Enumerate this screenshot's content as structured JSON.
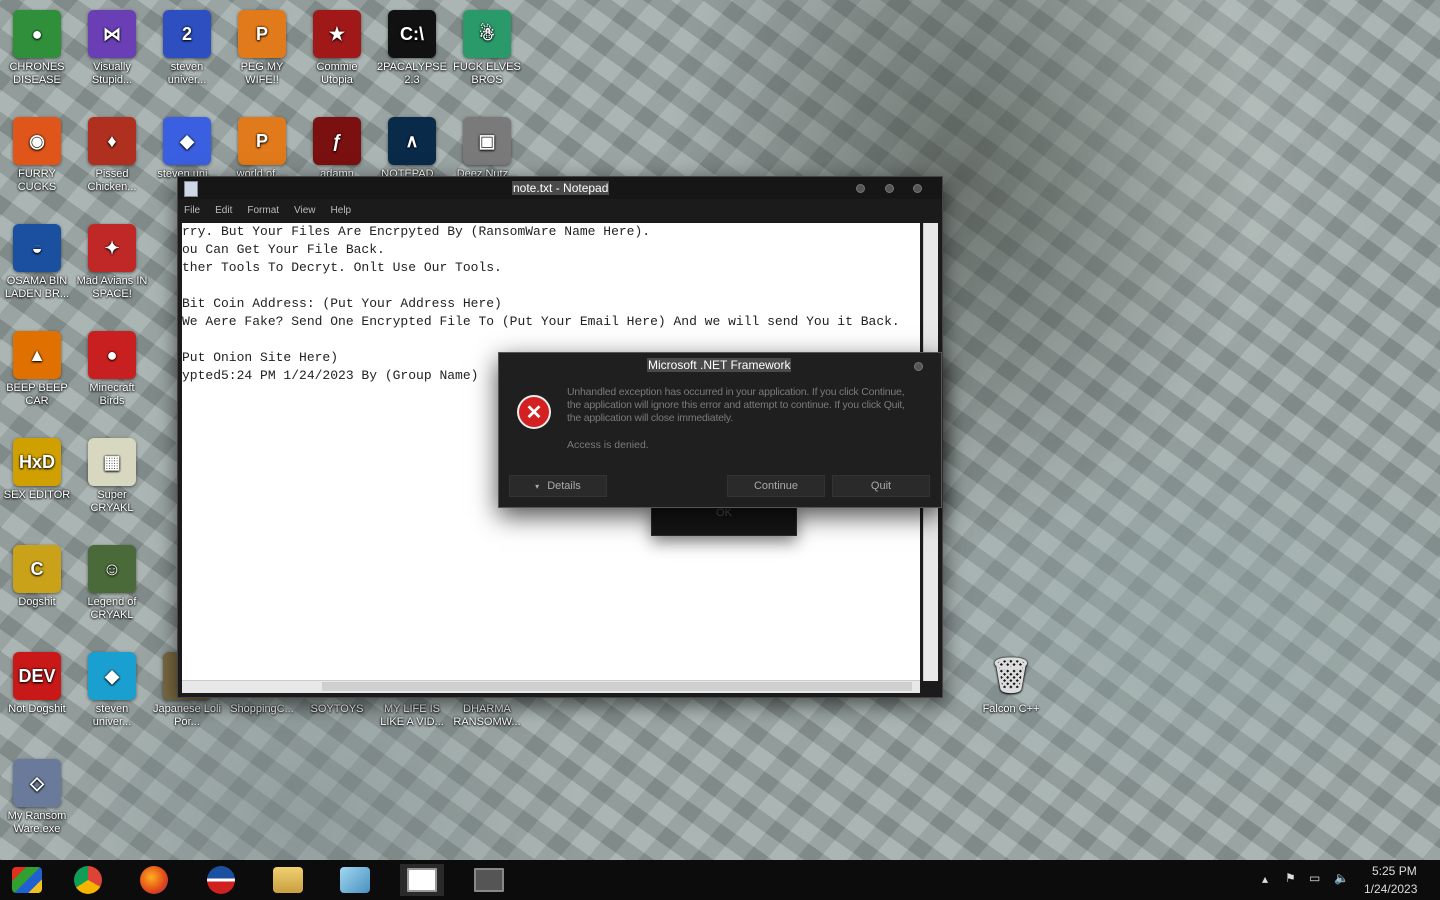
{
  "desktop_icons": [
    {
      "label": "CHRONES DISEASE",
      "icon": "chrome-icon",
      "color": "#2f8f3a",
      "glyph": "●"
    },
    {
      "label": "Visually Stupid...",
      "icon": "visual-studio-icon",
      "color": "#6a3fb5",
      "glyph": "⋈"
    },
    {
      "label": "steven univer...",
      "icon": "number-2-icon",
      "color": "#2d4fbf",
      "glyph": "2"
    },
    {
      "label": "PEG MY WIFE!!",
      "icon": "peggle-icon",
      "color": "#e07a1a",
      "glyph": "P"
    },
    {
      "label": "Commie Utopia",
      "icon": "commie-utopia-icon",
      "color": "#a01818",
      "glyph": "★"
    },
    {
      "label": "2PACALYPSE 2.3",
      "icon": "cmd-icon",
      "color": "#111111",
      "glyph": "C:\\"
    },
    {
      "label": "FUCK ELVES BROS",
      "icon": "elf-game-icon",
      "color": "#2a9a6a",
      "glyph": "☃"
    },
    {
      "label": "FURRY CUCKS",
      "icon": "firefox-icon",
      "color": "#e0561a",
      "glyph": "◉"
    },
    {
      "label": "Pissed Chicken...",
      "icon": "angry-birds-seasons-icon",
      "color": "#b03020",
      "glyph": "♦"
    },
    {
      "label": "steven uni...",
      "icon": "gem-icon",
      "color": "#3a5fe0",
      "glyph": "◆"
    },
    {
      "label": "world of ...",
      "icon": "peggle-icon",
      "color": "#e07a1a",
      "glyph": "P"
    },
    {
      "label": "adamn lanza...",
      "icon": "flash-icon",
      "color": "#7a1010",
      "glyph": "ƒ"
    },
    {
      "label": "NOTEPAD...",
      "icon": "notepad-plus-icon",
      "color": "#0a2a4a",
      "glyph": "∧"
    },
    {
      "label": "Deez Nutz...",
      "icon": "windows-stack-icon",
      "color": "#7a7a7a",
      "glyph": "▣"
    },
    {
      "label": "OSAMA BIN LADEN BR...",
      "icon": "obama-logo-icon",
      "color": "#1b4fa0",
      "glyph": "◒"
    },
    {
      "label": "Mad Avians IN SPACE!",
      "icon": "angry-birds-space-icon",
      "color": "#c02828",
      "glyph": "✦"
    },
    {
      "label": "BEEP BEEP CAR",
      "icon": "vlc-icon",
      "color": "#e07000",
      "glyph": "▲"
    },
    {
      "label": "Minecraft Birds",
      "icon": "angry-bird-icon",
      "color": "#c82020",
      "glyph": "●"
    },
    {
      "label": "SEX EDITOR",
      "icon": "hxd-icon",
      "color": "#d0a000",
      "glyph": "HxD"
    },
    {
      "label": "Super CRYAKL",
      "icon": "pixel-art-icon",
      "color": "#d8d8c0",
      "glyph": "▦"
    },
    {
      "label": "Dogshit",
      "icon": "gcc-icon",
      "color": "#caa21a",
      "glyph": "C"
    },
    {
      "label": "Legend of CRYAKL",
      "icon": "pixel-character-icon",
      "color": "#4a6a3a",
      "glyph": "☺"
    },
    {
      "label": "Not Dogshit",
      "icon": "dev-cpp-icon",
      "color": "#c81818",
      "glyph": "DEV"
    },
    {
      "label": "steven univer...",
      "icon": "diamond-icon",
      "color": "#1aa0d0",
      "glyph": "◆"
    },
    {
      "label": "My Ransom Ware.exe",
      "icon": "exe-file-icon",
      "color": "#6a7a9a",
      "glyph": "◇"
    },
    {
      "label": "Japanese Loli Por...",
      "icon": "file-icon",
      "color": "#7a6a40",
      "glyph": "▮"
    },
    {
      "label": "ShoppingC...",
      "icon": "folder-icon",
      "color": "#8a8a8a",
      "glyph": ""
    },
    {
      "label": "SOYTOYS",
      "icon": "folder-icon",
      "color": "#8a8a8a",
      "glyph": ""
    },
    {
      "label": "MY LIFE IS LIKE A VID...",
      "icon": "file-icon",
      "color": "#8a8a8a",
      "glyph": ""
    },
    {
      "label": "DHARMA RANSOMW...",
      "icon": "file-icon",
      "color": "#8a8a8a",
      "glyph": ""
    },
    {
      "label": "Falcon C++",
      "icon": "recycle-bin-icon",
      "color": "#e8e8e8",
      "glyph": "🗑"
    }
  ],
  "notepad": {
    "title": "note.txt - Notepad",
    "menu": [
      "File",
      "Edit",
      "Format",
      "View",
      "Help"
    ],
    "lines": [
      "rry. But Your Files Are Encrpyted By (RansomWare Name Here).",
      "ou Can Get Your File Back.",
      "ther Tools To Decryt. Onlt Use Our Tools.",
      "",
      "Bit Coin Address: (Put Your Address Here)",
      "We Aere Fake? Send One Encrypted File To (Put Your Email Here) And we will send You it Back.",
      "",
      "Put Onion Site Here)",
      "ypted5:24 PM 1/24/2023 By (Group Name)"
    ]
  },
  "dialog": {
    "title": "Microsoft .NET Framework",
    "message": "Unhandled exception has occurred in your application. If you click Continue, the application will ignore this error and attempt to continue. If you click Quit, the application will close immediately.",
    "detail": "Access is denied.",
    "details_button": "Details",
    "continue_button": "Continue",
    "quit_button": "Quit",
    "ok_button": "OK"
  },
  "taskbar": {
    "time": "5:25 PM",
    "date": "1/24/2023",
    "items": [
      "start-orb-icon",
      "chrome-icon",
      "firefox-icon",
      "obama-logo-icon",
      "file-explorer-icon",
      "notepad-icon",
      "active-window-icon",
      "window-icon"
    ]
  }
}
